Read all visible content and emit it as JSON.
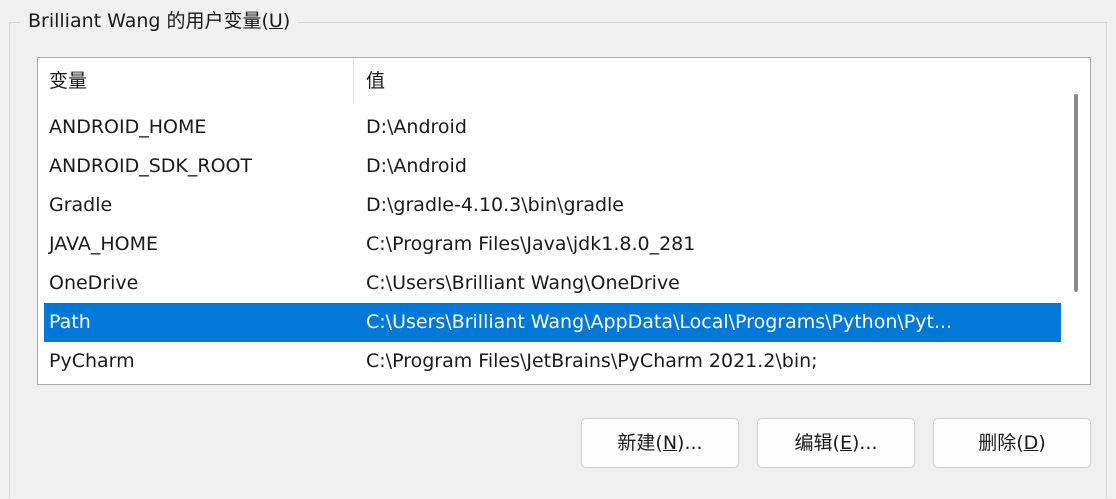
{
  "group": {
    "title_prefix": "Brilliant Wang 的用户变量(",
    "title_mnemonic": "U",
    "title_suffix": ")"
  },
  "table": {
    "columns": [
      "变量",
      "值"
    ],
    "rows": [
      {
        "name": "ANDROID_HOME",
        "value": "D:\\Android",
        "selected": false
      },
      {
        "name": "ANDROID_SDK_ROOT",
        "value": "D:\\Android",
        "selected": false
      },
      {
        "name": "Gradle",
        "value": "D:\\gradle-4.10.3\\bin\\gradle",
        "selected": false
      },
      {
        "name": "JAVA_HOME",
        "value": "C:\\Program Files\\Java\\jdk1.8.0_281",
        "selected": false
      },
      {
        "name": "OneDrive",
        "value": "C:\\Users\\Brilliant Wang\\OneDrive",
        "selected": false
      },
      {
        "name": "Path",
        "value": "C:\\Users\\Brilliant Wang\\AppData\\Local\\Programs\\Python\\Pyt...",
        "selected": true
      },
      {
        "name": "PyCharm",
        "value": "C:\\Program Files\\JetBrains\\PyCharm 2021.2\\bin;",
        "selected": false
      }
    ],
    "selection_color": "#0078d7"
  },
  "buttons": {
    "new": {
      "prefix": "新建(",
      "mnemonic": "N",
      "suffix": ")..."
    },
    "edit": {
      "prefix": "编辑(",
      "mnemonic": "E",
      "suffix": ")..."
    },
    "delete": {
      "prefix": "删除(",
      "mnemonic": "D",
      "suffix": ")"
    }
  }
}
